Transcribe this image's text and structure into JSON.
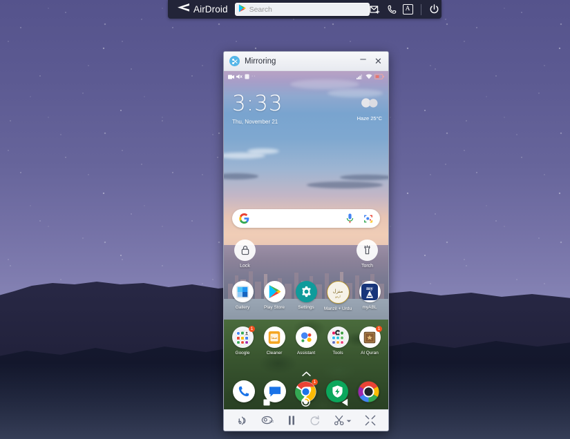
{
  "airdroid": {
    "brand": "AirDroid",
    "logo_icon": "airdroid-arrow-logo",
    "search": {
      "placeholder": "Search",
      "value": "",
      "leading_icon": "play-store-icon"
    },
    "actions": [
      {
        "name": "message-icon",
        "label": "Messages"
      },
      {
        "name": "phone-icon",
        "label": "Calls"
      },
      {
        "name": "apps-a-icon",
        "label": "A"
      },
      {
        "name": "power-icon",
        "label": "Power"
      }
    ]
  },
  "window": {
    "title": "Mirroring",
    "app_icon": "mirroring-icon",
    "minimize_label": "–",
    "close_label": "✕"
  },
  "phone": {
    "status_bar": {
      "notification_icons": [
        "screen-record-icon",
        "volume-mute-icon",
        "app-notif-icon"
      ],
      "overflow_dots": "··",
      "signal_icon": "signal-bars-icon",
      "wifi_icon": "wifi-icon",
      "battery_icon": "battery-low-icon"
    },
    "clock": {
      "time": "3:33",
      "date": "Thu, November 21"
    },
    "weather": {
      "icon": "haze-cloud-icon",
      "condition": "Haze",
      "temperature": "25°C",
      "text": "Haze  25°C"
    },
    "search_bar": {
      "google_icon": "google-g-icon",
      "mic_icon": "microphone-icon",
      "lens_icon": "google-lens-icon"
    },
    "shortcuts": [
      {
        "label": "Lock",
        "icon": "lock-icon"
      },
      {
        "label": "Torch",
        "icon": "torch-icon"
      }
    ],
    "app_rows": [
      [
        {
          "label": "Gallery",
          "icon": "gallery-icon",
          "badge": ""
        },
        {
          "label": "Play Store",
          "icon": "play-store-icon",
          "badge": ""
        },
        {
          "label": "Settings",
          "icon": "settings-gear-icon",
          "badge": ""
        },
        {
          "label": "Manzil + Urdu",
          "icon": "manzil-urdu-icon",
          "badge": ""
        },
        {
          "label": "myABL",
          "icon": "myabl-icon",
          "badge": ""
        }
      ],
      [
        {
          "label": "Google",
          "icon": "google-folder-icon",
          "badge": "1"
        },
        {
          "label": "Cleaner",
          "icon": "cleaner-icon",
          "badge": ""
        },
        {
          "label": "Assistant",
          "icon": "google-assistant-icon",
          "badge": ""
        },
        {
          "label": "Tools",
          "icon": "tools-folder-icon",
          "badge": ""
        },
        {
          "label": "Al Quran",
          "icon": "al-quran-icon",
          "badge": "1"
        }
      ]
    ],
    "drawer_arrow_icon": "chevron-up-icon",
    "dock": [
      {
        "label": "Phone",
        "icon": "phone-dialer-icon",
        "badge": ""
      },
      {
        "label": "Messages",
        "icon": "messages-icon",
        "badge": ""
      },
      {
        "label": "Chrome",
        "icon": "chrome-icon",
        "badge": "1"
      },
      {
        "label": "Security",
        "icon": "security-bolt-icon",
        "badge": ""
      },
      {
        "label": "Camera",
        "icon": "camera-icon",
        "badge": ""
      }
    ],
    "nav_bar": [
      {
        "name": "recents-button",
        "icon": "square-icon"
      },
      {
        "name": "home-button",
        "icon": "circle-icon"
      },
      {
        "name": "back-button",
        "icon": "triangle-back-icon"
      }
    ]
  },
  "toolbar": [
    {
      "name": "audio-button",
      "icon": "sound-waves-icon",
      "label": "Audio",
      "disabled": false
    },
    {
      "name": "screenshot-button",
      "icon": "screenshot-sd-icon",
      "label": "Screenshot",
      "disabled": false
    },
    {
      "name": "pause-button",
      "icon": "pause-icon",
      "label": "Pause",
      "disabled": false
    },
    {
      "name": "rotate-button",
      "icon": "rotate-icon",
      "label": "Rotate",
      "disabled": true
    },
    {
      "name": "record-cut-button",
      "icon": "scissors-icon",
      "label": "Cut",
      "disabled": false,
      "has_dropdown": true
    },
    {
      "name": "fullscreen-button",
      "icon": "fullscreen-icon",
      "label": "Full screen",
      "disabled": false
    }
  ],
  "colors": {
    "airdroid_bar": "#222438",
    "window_chrome": "#f2f3f7",
    "accent_badge": "#f4511e",
    "desktop_sky": "#55538c"
  }
}
